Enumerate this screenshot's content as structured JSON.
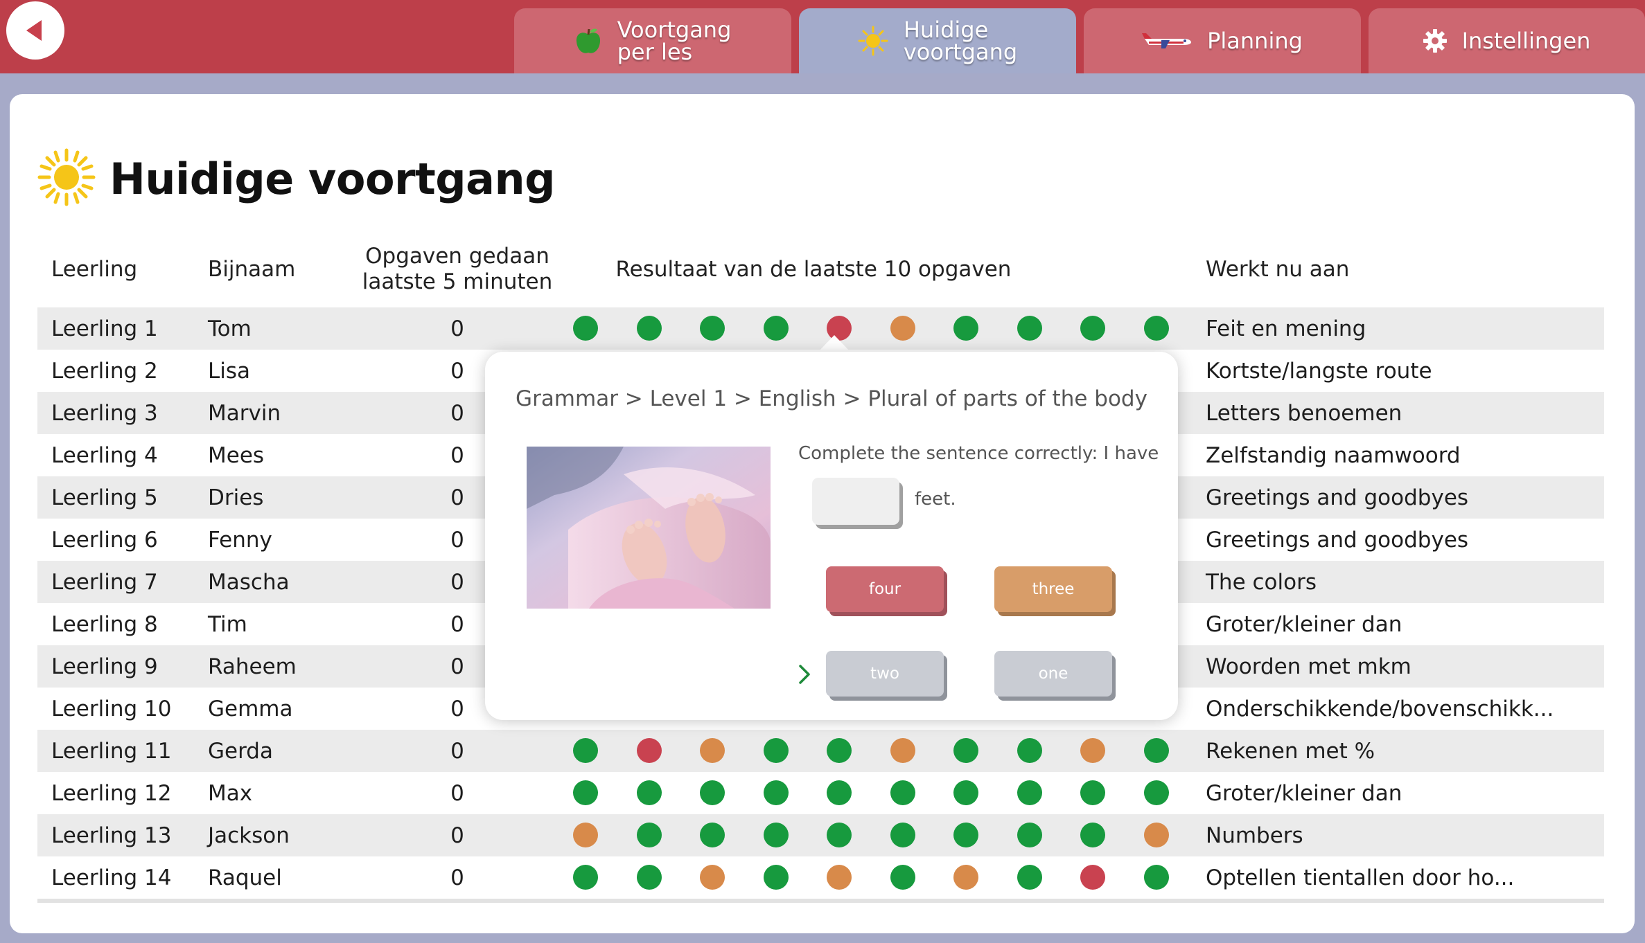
{
  "colors": {
    "topbar": "#bd3f4a",
    "tab_inactive": "#cd6771",
    "tab_active": "#a3abcb",
    "dot_green": "#179a3e",
    "dot_orange": "#d88a4a",
    "dot_red": "#c94250",
    "sun": "#f5c518"
  },
  "nav": {
    "back_icon": "back-arrow-icon",
    "tabs": [
      {
        "label": "Voortgang\nper les",
        "icon": "apple-icon",
        "active": false
      },
      {
        "label": "Huidige\nvoortgang",
        "icon": "sun-icon",
        "active": true
      },
      {
        "label": "Planning",
        "icon": "airplane-icon",
        "active": false
      },
      {
        "label": "Instellingen",
        "icon": "gear-icon",
        "active": false
      }
    ]
  },
  "page": {
    "title": "Huidige voortgang",
    "title_icon": "sun-icon"
  },
  "table": {
    "headers": {
      "leerling": "Leerling",
      "bijnaam": "Bijnaam",
      "opgaven": "Opgaven gedaan laatste 5 minuten",
      "resultaat": "Resultaat van de laatste 10 opgaven",
      "werkt": "Werkt nu aan"
    },
    "rows": [
      {
        "leerling": "Leerling 1",
        "bijnaam": "Tom",
        "opgaven": "0",
        "results": [
          "green",
          "green",
          "green",
          "green",
          "red",
          "orange",
          "green",
          "green",
          "green",
          "green"
        ],
        "werkt": "Feit en mening"
      },
      {
        "leerling": "Leerling 2",
        "bijnaam": "Lisa",
        "opgaven": "0",
        "results": [],
        "werkt": "Kortste/langste route"
      },
      {
        "leerling": "Leerling 3",
        "bijnaam": "Marvin",
        "opgaven": "0",
        "results": [],
        "werkt": "Letters benoemen"
      },
      {
        "leerling": "Leerling 4",
        "bijnaam": "Mees",
        "opgaven": "0",
        "results": [],
        "werkt": "Zelfstandig naamwoord"
      },
      {
        "leerling": "Leerling 5",
        "bijnaam": "Dries",
        "opgaven": "0",
        "results": [],
        "werkt": "Greetings and goodbyes"
      },
      {
        "leerling": "Leerling 6",
        "bijnaam": "Fenny",
        "opgaven": "0",
        "results": [],
        "werkt": "Greetings and goodbyes"
      },
      {
        "leerling": "Leerling 7",
        "bijnaam": "Mascha",
        "opgaven": "0",
        "results": [],
        "werkt": "The colors"
      },
      {
        "leerling": "Leerling 8",
        "bijnaam": "Tim",
        "opgaven": "0",
        "results": [],
        "werkt": "Groter/kleiner dan"
      },
      {
        "leerling": "Leerling 9",
        "bijnaam": "Raheem",
        "opgaven": "0",
        "results": [],
        "werkt": "Woorden met mkm"
      },
      {
        "leerling": "Leerling 10",
        "bijnaam": "Gemma",
        "opgaven": "0",
        "results": [],
        "werkt": "Onderschikkende/bovenschikk..."
      },
      {
        "leerling": "Leerling 11",
        "bijnaam": "Gerda",
        "opgaven": "0",
        "results": [
          "green",
          "red",
          "orange",
          "green",
          "green",
          "orange",
          "green",
          "green",
          "orange",
          "green"
        ],
        "werkt": "Rekenen met %"
      },
      {
        "leerling": "Leerling 12",
        "bijnaam": "Max",
        "opgaven": "0",
        "results": [
          "green",
          "green",
          "green",
          "green",
          "green",
          "green",
          "green",
          "green",
          "green",
          "green"
        ],
        "werkt": "Groter/kleiner dan"
      },
      {
        "leerling": "Leerling 13",
        "bijnaam": "Jackson",
        "opgaven": "0",
        "results": [
          "orange",
          "green",
          "green",
          "green",
          "green",
          "green",
          "green",
          "green",
          "green",
          "orange"
        ],
        "werkt": "Numbers"
      },
      {
        "leerling": "Leerling 14",
        "bijnaam": "Raquel",
        "opgaven": "0",
        "results": [
          "green",
          "green",
          "orange",
          "green",
          "orange",
          "green",
          "orange",
          "green",
          "red",
          "green"
        ],
        "werkt": "Optellen tientallen door ho..."
      }
    ]
  },
  "popup": {
    "breadcrumb": "Grammar > Level 1 > English > Plural of parts of the body",
    "image_icon": "baby-feet-photo",
    "question": "Complete the sentence correctly: I have",
    "answer_suffix": "feet.",
    "choices": [
      "four",
      "three",
      "two",
      "one"
    ],
    "pointer_icon": "chevron-right-icon"
  }
}
